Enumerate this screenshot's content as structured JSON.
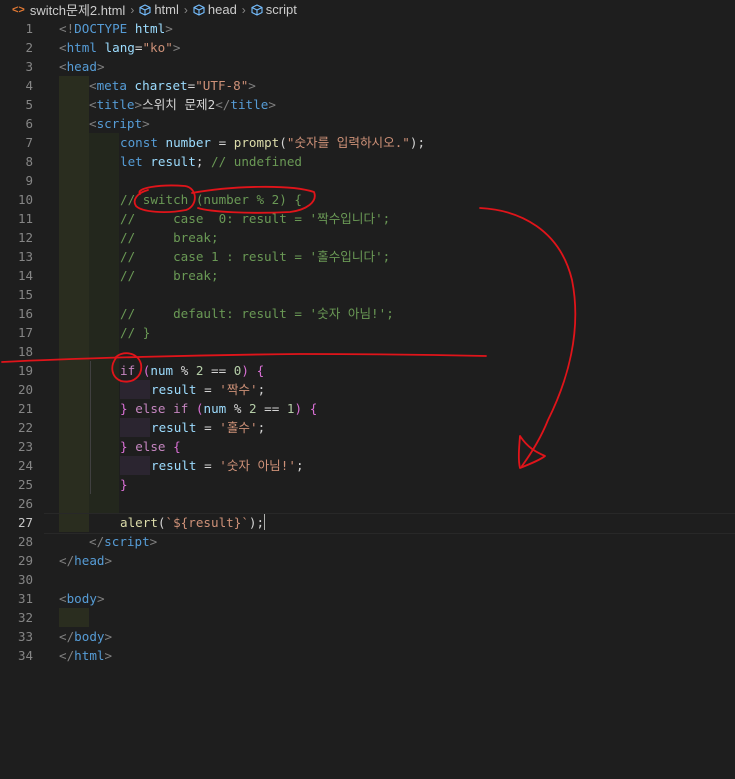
{
  "breadcrumb": {
    "file": "switch문제2.html",
    "items": [
      "html",
      "head",
      "script"
    ]
  },
  "editor": {
    "active_line": 27,
    "line_numbers": [
      "1",
      "2",
      "3",
      "4",
      "5",
      "6",
      "7",
      "8",
      "9",
      "10",
      "11",
      "12",
      "13",
      "14",
      "15",
      "16",
      "17",
      "18",
      "19",
      "20",
      "21",
      "22",
      "23",
      "24",
      "25",
      "26",
      "27",
      "28",
      "29",
      "30",
      "31",
      "32",
      "33",
      "34"
    ],
    "code": {
      "l1": "DOCTYPE",
      "l1b": "html",
      "l2_tag": "html",
      "l2_attr": "lang",
      "l2_val": "\"ko\"",
      "l3_tag": "head",
      "l4_tag": "meta",
      "l4_attr": "charset",
      "l4_val": "\"UTF-8\"",
      "l5_tag": "title",
      "l5_text": "스위치 문제2",
      "l6_tag": "script",
      "l7_kw": "const",
      "l7_var": "number",
      "l7_fn": "prompt",
      "l7_str": "\"숫자를 입력하시오.\"",
      "l8_kw": "let",
      "l8_var": "result",
      "l8_cmt": "// undefined",
      "l10": "// switch (number % 2) {",
      "l11": "//     case  0: result = '짝수입니다';",
      "l12": "//     break;",
      "l13": "//     case 1 : result = '홀수입니다';",
      "l14": "//     break;",
      "l16": "//     default: result = '숫자 아님!';",
      "l17": "// }",
      "l19_kw": "if",
      "l19_var": "num",
      "l19_op": " % ",
      "l19_n1": "2",
      "l19_eq": " == ",
      "l19_n2": "0",
      "l20_var": "result",
      "l20_str": "'짝수'",
      "l21_kw1": "else",
      "l21_kw2": "if",
      "l21_var": "num",
      "l21_n1": "2",
      "l21_n2": "1",
      "l22_var": "result",
      "l22_str": "'홀수'",
      "l23_kw": "else",
      "l24_var": "result",
      "l24_str": "'숫자 아님!'",
      "l27_fn": "alert",
      "l27_tpl": "`${result}`",
      "l28_tag": "script",
      "l29_tag": "head",
      "l31_tag": "body",
      "l33_tag": "body",
      "l34_tag": "html"
    }
  },
  "colors": {
    "background": "#1e1e1e",
    "annotation": "#e0141a"
  }
}
